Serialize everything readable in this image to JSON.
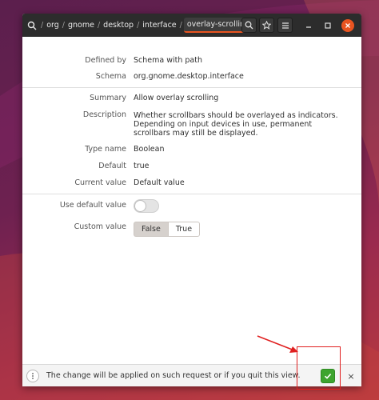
{
  "breadcrumb": [
    "org",
    "gnome",
    "desktop",
    "interface",
    "overlay-scrolling"
  ],
  "header": {
    "search_icon": "search-icon",
    "bookmark_icon": "star-icon",
    "menu_icon": "hamburger-menu-icon",
    "minimize_icon": "minimize-icon",
    "maximize_icon": "maximize-icon",
    "close_icon": "close-icon"
  },
  "info": {
    "defined_by_label": "Defined by",
    "defined_by_value": "Schema with path",
    "schema_label": "Schema",
    "schema_value": "org.gnome.desktop.interface",
    "summary_label": "Summary",
    "summary_value": "Allow overlay scrolling",
    "description_label": "Description",
    "description_value": "Whether scrollbars should be overlayed as indicators. Depending on input devices in use, permanent scrollbars may still be displayed.",
    "type_label": "Type name",
    "type_value": "Boolean",
    "default_label": "Default",
    "default_value": "true",
    "current_label": "Current value",
    "current_value": "Default value"
  },
  "settings": {
    "use_default_label": "Use default value",
    "use_default_on": false,
    "custom_label": "Custom value",
    "option_false": "False",
    "option_true": "True",
    "selected": "False"
  },
  "bottombar": {
    "message": "The change will be applied on such request or if you quit this view.",
    "more_icon": "vertical-dots-icon",
    "apply_icon": "checkmark-icon",
    "dismiss_label": "×"
  },
  "colors": {
    "accent": "#e95420",
    "apply_green": "#3ea42f",
    "annotation_red": "#e02020"
  }
}
